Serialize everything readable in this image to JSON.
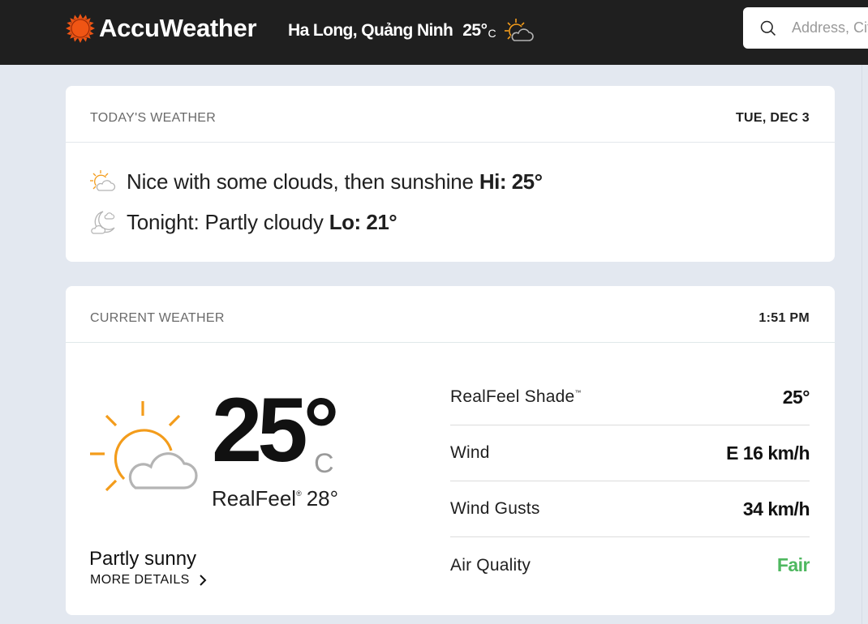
{
  "header": {
    "brand": "AccuWeather",
    "location": "Ha Long, Quảng Ninh",
    "temp": "25°",
    "unit": "C",
    "icon": "partly-sunny-icon",
    "search": {
      "placeholder": "Address, City or Zip Code",
      "value": ""
    }
  },
  "today": {
    "title": "TODAY'S WEATHER",
    "date": "TUE, DEC 3",
    "day": {
      "icon": "partly-sunny-icon",
      "text": "Nice with some clouds, then sunshine",
      "hilo": "Hi: 25°"
    },
    "night": {
      "icon": "partly-cloudy-night-icon",
      "text": "Tonight: Partly cloudy",
      "hilo": "Lo: 21°"
    }
  },
  "current": {
    "title": "CURRENT WEATHER",
    "time": "1:51 PM",
    "icon": "partly-sunny-icon",
    "temp": "25°",
    "unit": "C",
    "realfeel_label": "RealFeel",
    "realfeel_mark": "®",
    "realfeel_value": "28°",
    "phrase": "Partly sunny",
    "more_details": "MORE DETAILS",
    "details": [
      {
        "label": "RealFeel Shade",
        "mark": "™",
        "value": "25°"
      },
      {
        "label": "Wind",
        "mark": "",
        "value": "E 16 km/h"
      },
      {
        "label": "Wind Gusts",
        "mark": "",
        "value": "34 km/h"
      },
      {
        "label": "Air Quality",
        "mark": "",
        "value": "Fair",
        "status_color": "#4fb860"
      }
    ]
  },
  "colors": {
    "brand_orange": "#f05514",
    "header_bg": "#1f1f1f",
    "page_bg": "#e3e8f0",
    "sun_orange": "#f39c1b",
    "cloud_gray": "#b4b4b4",
    "air_quality_fair": "#4fb860"
  }
}
